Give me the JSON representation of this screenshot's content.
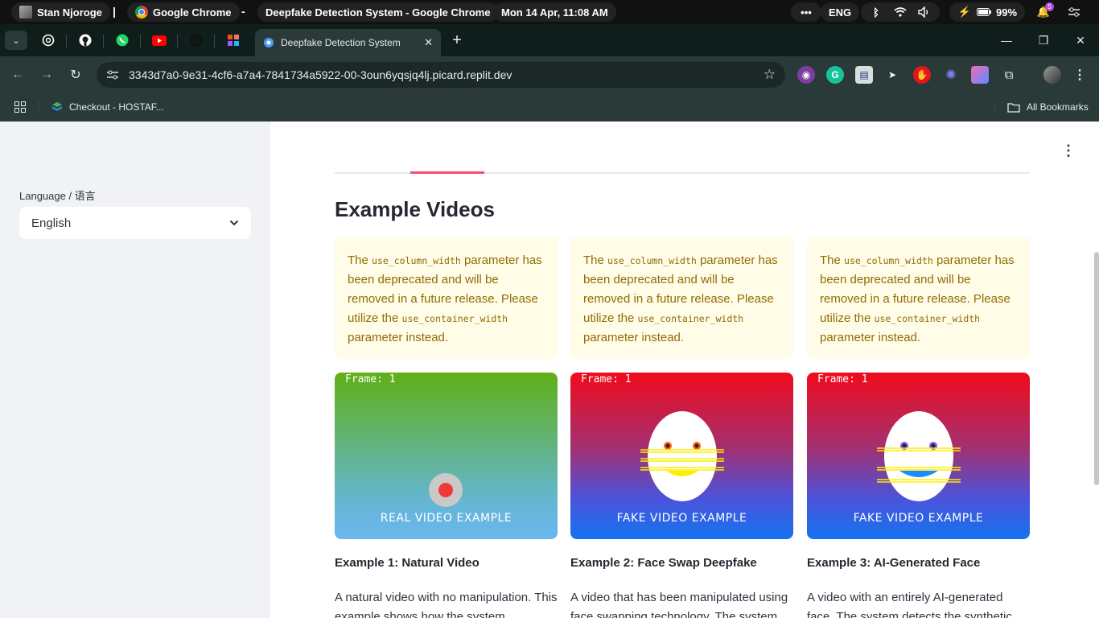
{
  "os_bar": {
    "user": "Stan Njoroge",
    "app_name": "Google Chrome",
    "window_title": "Deepfake Detection System - Google Chrome",
    "datetime": "Mon 14 Apr, 11:08 AM",
    "language": "ENG",
    "battery": "99%",
    "notification_count": "5"
  },
  "browser": {
    "active_tab_title": "Deepfake Detection System",
    "url": "3343d7a0-9e31-4cf6-a7a4-7841734a5922-00-3oun6yqsjq4lj.picard.replit.dev",
    "bookmarks": [
      {
        "label": "Checkout - HOSTAF..."
      }
    ],
    "all_bookmarks_label": "All Bookmarks"
  },
  "sidebar": {
    "language_label": "Language / 语言",
    "language_value": "English"
  },
  "main": {
    "section_title": "Example Videos",
    "warnings": [
      {
        "pre": "The ",
        "code1": "use_column_width",
        "mid": " parameter has been deprecated and will be removed in a future release. Please utilize the ",
        "code2": "use_container_width",
        "post": " parameter instead."
      },
      {
        "pre": "The ",
        "code1": "use_column_width",
        "mid": " parameter has been deprecated and will be removed in a future release. Please utilize the ",
        "code2": "use_container_width",
        "post": " parameter instead."
      },
      {
        "pre": "The ",
        "code1": "use_column_width",
        "mid": " parameter has been deprecated and will be removed in a future release. Please utilize the ",
        "code2": "use_container_width",
        "post": " parameter instead."
      }
    ],
    "examples": [
      {
        "frame_label": "Frame: 1",
        "video_caption": "REAL VIDEO EXAMPLE",
        "title": "Example 1: Natural Video",
        "description": "A natural video with no manipulation. This example shows how the system"
      },
      {
        "frame_label": "Frame: 1",
        "video_caption": "FAKE VIDEO EXAMPLE",
        "title": "Example 2: Face Swap Deepfake",
        "description": "A video that has been manipulated using face swapping technology. The system"
      },
      {
        "frame_label": "Frame: 1",
        "video_caption": "FAKE VIDEO EXAMPLE",
        "title": "Example 3: AI-Generated Face",
        "description": "A video with an entirely AI-generated face. The system detects the synthetic"
      }
    ]
  },
  "colors": {
    "accent": "#ff4b6b",
    "warning_bg": "#fffce7",
    "warning_text": "#926c05",
    "sidebar_bg": "#f0f2f6"
  }
}
